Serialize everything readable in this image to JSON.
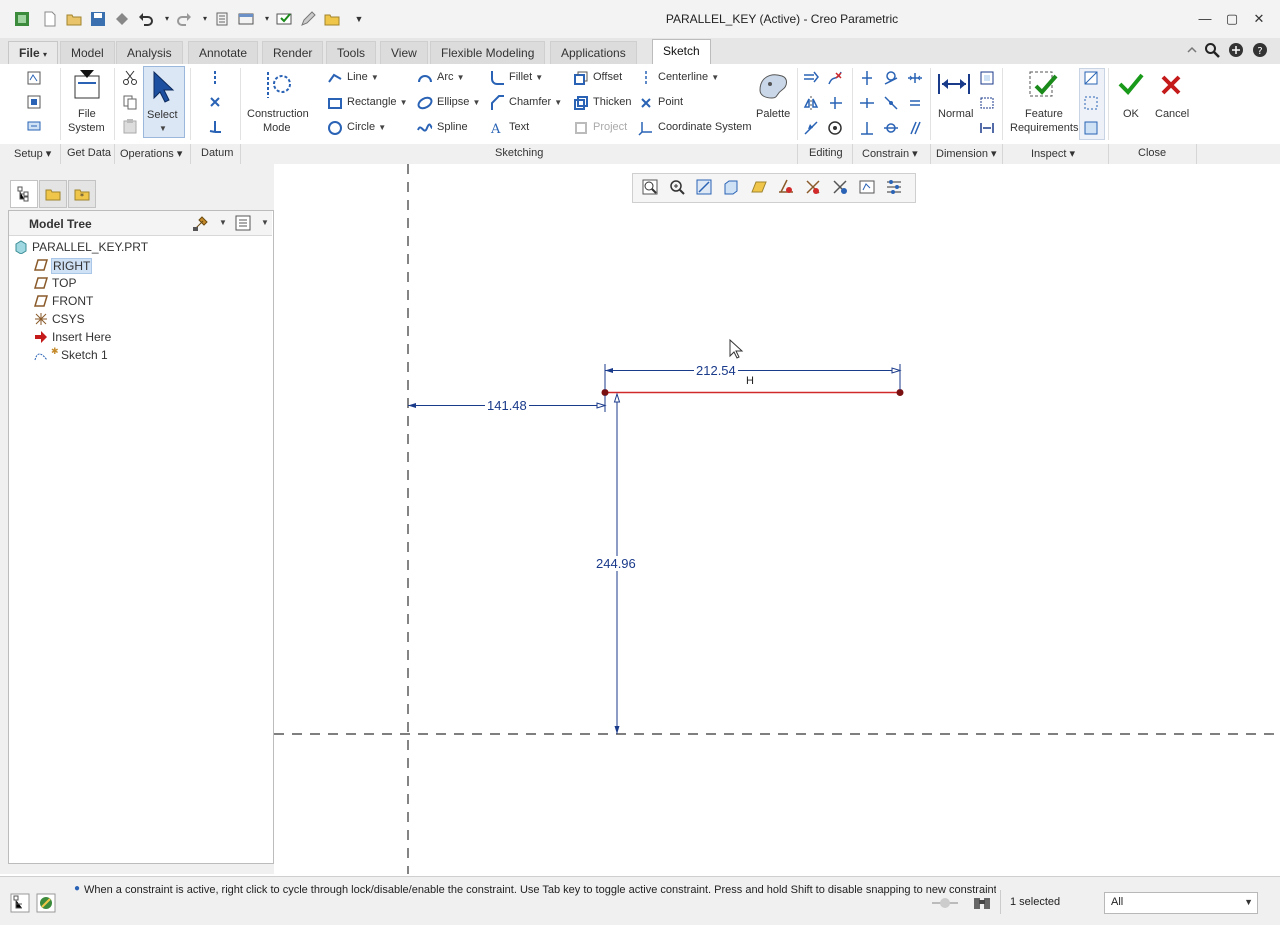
{
  "window": {
    "title": "PARALLEL_KEY (Active) - Creo Parametric"
  },
  "tabs": [
    {
      "label": "File",
      "caret": "▾"
    },
    {
      "label": "Model"
    },
    {
      "label": "Analysis"
    },
    {
      "label": "Annotate"
    },
    {
      "label": "Render"
    },
    {
      "label": "Tools"
    },
    {
      "label": "View"
    },
    {
      "label": "Flexible Modeling"
    },
    {
      "label": "Applications"
    },
    {
      "label": "Sketch"
    }
  ],
  "ribbon": {
    "file_system": "File\nSystem",
    "file_system_l1": "File",
    "file_system_l2": "System",
    "select": "Select",
    "construction_l1": "Construction",
    "construction_l2": "Mode",
    "line": "Line",
    "rectangle": "Rectangle",
    "circle": "Circle",
    "arc": "Arc",
    "ellipse": "Ellipse",
    "spline": "Spline",
    "fillet": "Fillet",
    "chamfer": "Chamfer",
    "text": "Text",
    "offset": "Offset",
    "thicken": "Thicken",
    "project": "Project",
    "centerline": "Centerline",
    "point": "Point",
    "coordinate_system": "Coordinate System",
    "palette": "Palette",
    "normal": "Normal",
    "feature_req_l1": "Feature",
    "feature_req_l2": "Requirements",
    "ok": "OK",
    "cancel": "Cancel"
  },
  "groups": [
    {
      "label": "Setup ▾"
    },
    {
      "label": "Get Data"
    },
    {
      "label": "Operations ▾"
    },
    {
      "label": "Datum"
    },
    {
      "label": "Sketching"
    },
    {
      "label": "Editing"
    },
    {
      "label": "Constrain ▾"
    },
    {
      "label": "Dimension ▾"
    },
    {
      "label": "Inspect ▾"
    },
    {
      "label": "Close"
    }
  ],
  "model_tree": {
    "title": "Model Tree",
    "items": [
      {
        "label": "PARALLEL_KEY.PRT",
        "icon": "part-icon"
      },
      {
        "label": "RIGHT",
        "icon": "datum-plane-icon"
      },
      {
        "label": "TOP",
        "icon": "datum-plane-icon"
      },
      {
        "label": "FRONT",
        "icon": "datum-plane-icon"
      },
      {
        "label": "CSYS",
        "icon": "csys-icon"
      },
      {
        "label": "Insert Here",
        "icon": "insert-arrow-icon"
      },
      {
        "label": "Sketch 1",
        "icon": "sketch-icon"
      }
    ]
  },
  "sketch": {
    "dim_width": "212.54",
    "dim_offset": "141.48",
    "dim_height": "244.96",
    "constraint_h": "H",
    "line_color": "#d12a2a",
    "dim_color": "#1a3a8a"
  },
  "status": {
    "message": "When a constraint is active, right click to cycle through lock/disable/enable the constraint. Use Tab key to toggle active constraint. Press and hold Shift to disable snapping to new constraints.",
    "selected": "1 selected",
    "filter": "All"
  }
}
